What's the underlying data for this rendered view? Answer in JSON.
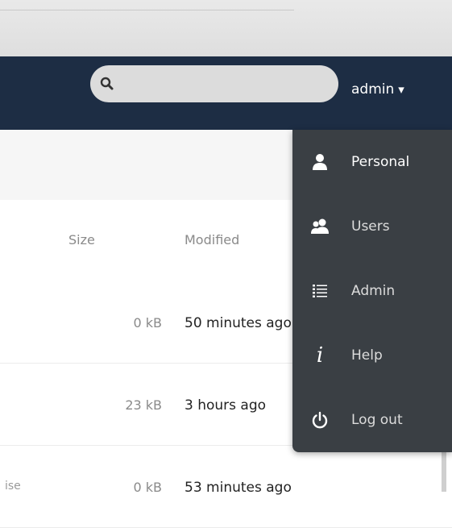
{
  "search": {
    "value": "",
    "placeholder": ""
  },
  "user_menu": {
    "username": "admin",
    "caret": "▾"
  },
  "columns": {
    "size": "Size",
    "modified": "Modified"
  },
  "rows": [
    {
      "name": "",
      "size": "0 kB",
      "modified": "50 minutes ago"
    },
    {
      "name": "",
      "size": "23 kB",
      "modified": "3 hours ago"
    },
    {
      "name": "ise",
      "size": "0 kB",
      "modified": "53 minutes ago"
    }
  ],
  "dropdown": {
    "items": [
      {
        "label": "Personal",
        "icon": "user-icon"
      },
      {
        "label": "Users",
        "icon": "users-icon"
      },
      {
        "label": "Admin",
        "icon": "list-icon"
      },
      {
        "label": "Help",
        "icon": "info-icon"
      },
      {
        "label": "Log out",
        "icon": "power-icon"
      }
    ]
  },
  "colors": {
    "header": "#1d2d44",
    "dropdown": "#3a3f44",
    "search_bg": "#dcdcdc"
  }
}
